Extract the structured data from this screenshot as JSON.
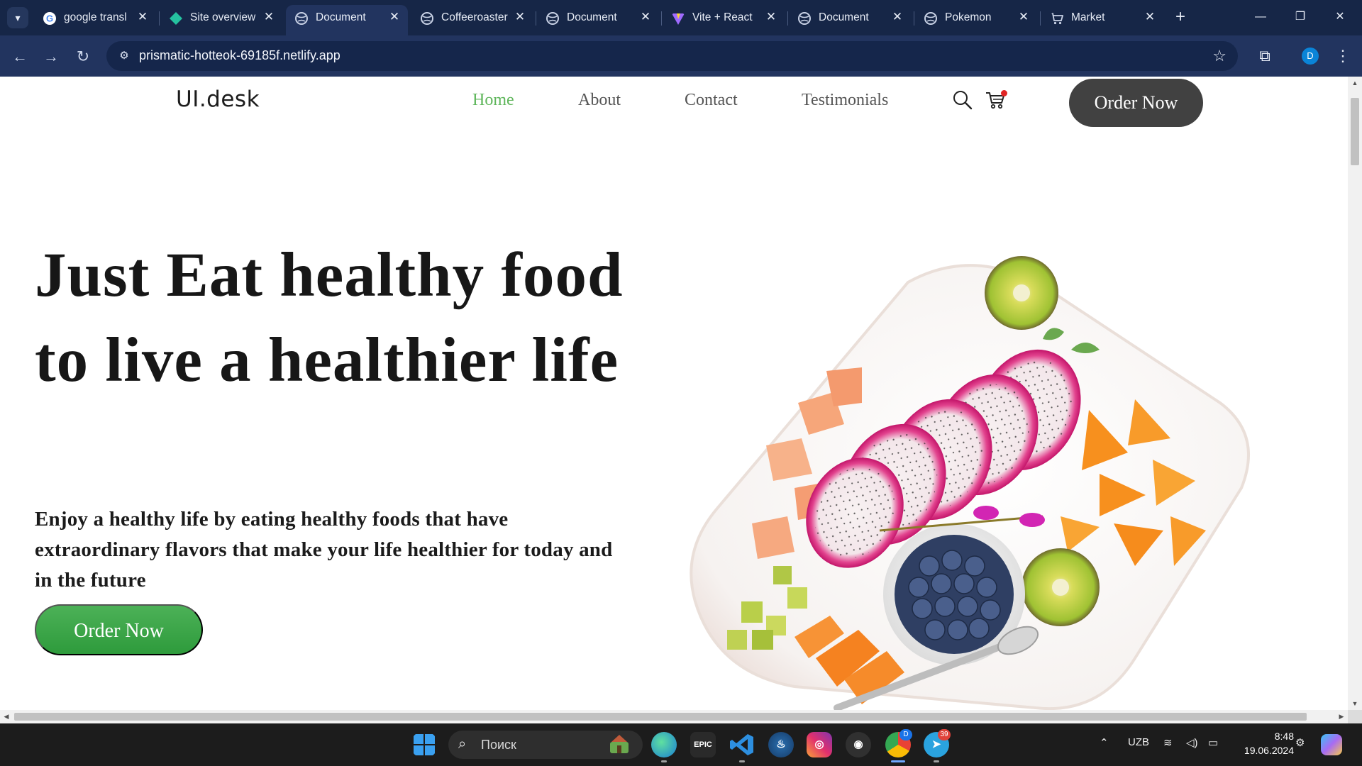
{
  "browser": {
    "tabs": [
      {
        "title": "google transl",
        "favicon": "google-icon",
        "active": false
      },
      {
        "title": "Site overview",
        "favicon": "netlify-icon",
        "active": false
      },
      {
        "title": "Document",
        "favicon": "globe-icon",
        "active": true
      },
      {
        "title": "Coffeeroaster",
        "favicon": "globe-icon",
        "active": false
      },
      {
        "title": "Document",
        "favicon": "globe-icon",
        "active": false
      },
      {
        "title": "Vite + React",
        "favicon": "vite-icon",
        "active": false
      },
      {
        "title": "Document",
        "favicon": "globe-icon",
        "active": false
      },
      {
        "title": "Pokemon",
        "favicon": "globe-icon",
        "active": false
      },
      {
        "title": "Market",
        "favicon": "cart-icon",
        "active": false
      }
    ],
    "url": "prismatic-hotteok-69185f.netlify.app",
    "profile_initial": "D"
  },
  "site": {
    "logo": "UI.desk",
    "nav": [
      "Home",
      "About",
      "Contact",
      "Testimonials"
    ],
    "active_nav": "Home",
    "order_button": "Order Now",
    "hero": {
      "title": "Just Eat healthy food to live a healthier life",
      "subtitle": "Enjoy a healthy life by eating healthy foods that have extraordinary flavors that make your life healthier for today and in the future",
      "cta": "Order Now"
    }
  },
  "taskbar": {
    "search_placeholder": "Поиск",
    "language": "UZB",
    "time": "8:48",
    "date": "19.06.2024",
    "chrome_profile_badge": "D",
    "telegram_badge": "39"
  },
  "colors": {
    "accent_green": "#5fb65b",
    "dark_button": "#414141",
    "chrome_dark": "#162647"
  }
}
